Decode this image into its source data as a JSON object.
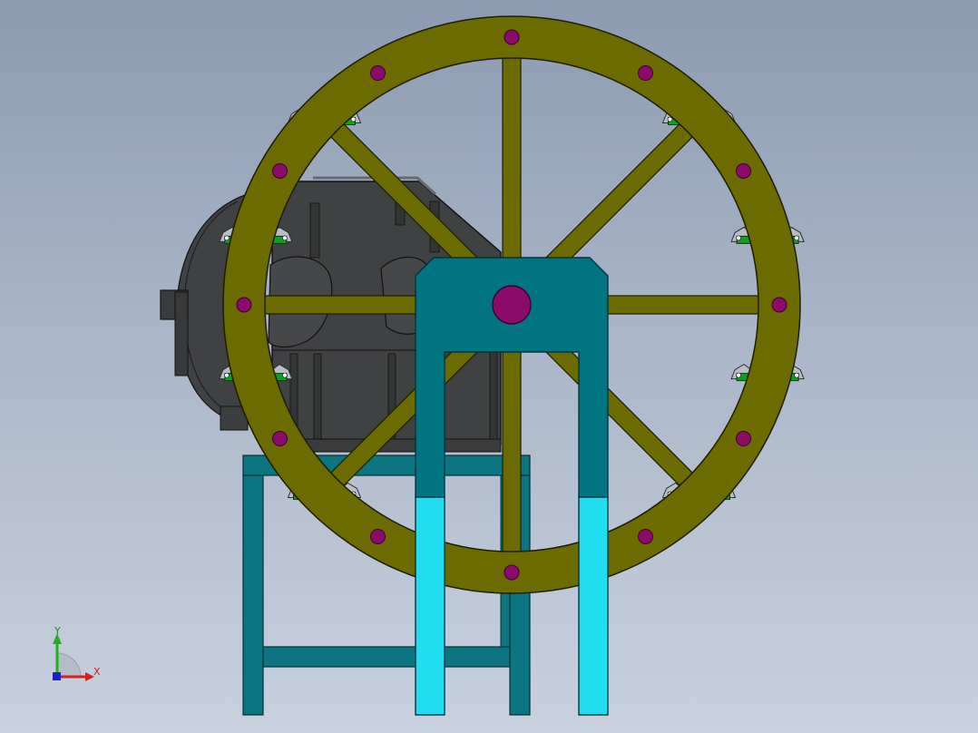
{
  "viewport": {
    "background_top": "#8c9bb2",
    "background_bottom": "#c9d1de"
  },
  "colors": {
    "wheel_rim": "#6b6b00",
    "wheel_spoke": "#6b6b00",
    "bolt": "#8b0a6a",
    "frame_support": "#007480",
    "frame_support_lower": "#22dcf2",
    "base_frame": "#0b7681",
    "gearbox": "#3f4042",
    "bucket_plate": "#0ea01e",
    "bucket_bracket": "#b9bec6"
  },
  "triad": {
    "y_label": "Y",
    "x_label": "X",
    "y_color": "#1fb11f",
    "x_color": "#d42020",
    "origin_color": "#2020c8"
  }
}
